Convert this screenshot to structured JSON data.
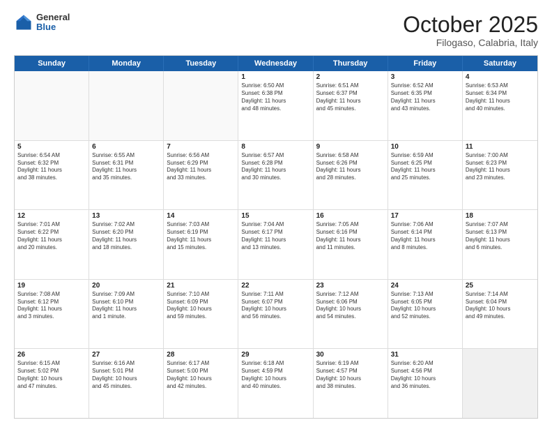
{
  "header": {
    "logo_general": "General",
    "logo_blue": "Blue",
    "month_title": "October 2025",
    "subtitle": "Filogaso, Calabria, Italy"
  },
  "weekdays": [
    "Sunday",
    "Monday",
    "Tuesday",
    "Wednesday",
    "Thursday",
    "Friday",
    "Saturday"
  ],
  "rows": [
    [
      {
        "day": "",
        "lines": [],
        "empty": true
      },
      {
        "day": "",
        "lines": [],
        "empty": true
      },
      {
        "day": "",
        "lines": [],
        "empty": true
      },
      {
        "day": "1",
        "lines": [
          "Sunrise: 6:50 AM",
          "Sunset: 6:38 PM",
          "Daylight: 11 hours",
          "and 48 minutes."
        ]
      },
      {
        "day": "2",
        "lines": [
          "Sunrise: 6:51 AM",
          "Sunset: 6:37 PM",
          "Daylight: 11 hours",
          "and 45 minutes."
        ]
      },
      {
        "day": "3",
        "lines": [
          "Sunrise: 6:52 AM",
          "Sunset: 6:35 PM",
          "Daylight: 11 hours",
          "and 43 minutes."
        ]
      },
      {
        "day": "4",
        "lines": [
          "Sunrise: 6:53 AM",
          "Sunset: 6:34 PM",
          "Daylight: 11 hours",
          "and 40 minutes."
        ]
      }
    ],
    [
      {
        "day": "5",
        "lines": [
          "Sunrise: 6:54 AM",
          "Sunset: 6:32 PM",
          "Daylight: 11 hours",
          "and 38 minutes."
        ]
      },
      {
        "day": "6",
        "lines": [
          "Sunrise: 6:55 AM",
          "Sunset: 6:31 PM",
          "Daylight: 11 hours",
          "and 35 minutes."
        ]
      },
      {
        "day": "7",
        "lines": [
          "Sunrise: 6:56 AM",
          "Sunset: 6:29 PM",
          "Daylight: 11 hours",
          "and 33 minutes."
        ]
      },
      {
        "day": "8",
        "lines": [
          "Sunrise: 6:57 AM",
          "Sunset: 6:28 PM",
          "Daylight: 11 hours",
          "and 30 minutes."
        ]
      },
      {
        "day": "9",
        "lines": [
          "Sunrise: 6:58 AM",
          "Sunset: 6:26 PM",
          "Daylight: 11 hours",
          "and 28 minutes."
        ]
      },
      {
        "day": "10",
        "lines": [
          "Sunrise: 6:59 AM",
          "Sunset: 6:25 PM",
          "Daylight: 11 hours",
          "and 25 minutes."
        ]
      },
      {
        "day": "11",
        "lines": [
          "Sunrise: 7:00 AM",
          "Sunset: 6:23 PM",
          "Daylight: 11 hours",
          "and 23 minutes."
        ]
      }
    ],
    [
      {
        "day": "12",
        "lines": [
          "Sunrise: 7:01 AM",
          "Sunset: 6:22 PM",
          "Daylight: 11 hours",
          "and 20 minutes."
        ]
      },
      {
        "day": "13",
        "lines": [
          "Sunrise: 7:02 AM",
          "Sunset: 6:20 PM",
          "Daylight: 11 hours",
          "and 18 minutes."
        ]
      },
      {
        "day": "14",
        "lines": [
          "Sunrise: 7:03 AM",
          "Sunset: 6:19 PM",
          "Daylight: 11 hours",
          "and 15 minutes."
        ]
      },
      {
        "day": "15",
        "lines": [
          "Sunrise: 7:04 AM",
          "Sunset: 6:17 PM",
          "Daylight: 11 hours",
          "and 13 minutes."
        ]
      },
      {
        "day": "16",
        "lines": [
          "Sunrise: 7:05 AM",
          "Sunset: 6:16 PM",
          "Daylight: 11 hours",
          "and 11 minutes."
        ]
      },
      {
        "day": "17",
        "lines": [
          "Sunrise: 7:06 AM",
          "Sunset: 6:14 PM",
          "Daylight: 11 hours",
          "and 8 minutes."
        ]
      },
      {
        "day": "18",
        "lines": [
          "Sunrise: 7:07 AM",
          "Sunset: 6:13 PM",
          "Daylight: 11 hours",
          "and 6 minutes."
        ]
      }
    ],
    [
      {
        "day": "19",
        "lines": [
          "Sunrise: 7:08 AM",
          "Sunset: 6:12 PM",
          "Daylight: 11 hours",
          "and 3 minutes."
        ]
      },
      {
        "day": "20",
        "lines": [
          "Sunrise: 7:09 AM",
          "Sunset: 6:10 PM",
          "Daylight: 11 hours",
          "and 1 minute."
        ]
      },
      {
        "day": "21",
        "lines": [
          "Sunrise: 7:10 AM",
          "Sunset: 6:09 PM",
          "Daylight: 10 hours",
          "and 59 minutes."
        ]
      },
      {
        "day": "22",
        "lines": [
          "Sunrise: 7:11 AM",
          "Sunset: 6:07 PM",
          "Daylight: 10 hours",
          "and 56 minutes."
        ]
      },
      {
        "day": "23",
        "lines": [
          "Sunrise: 7:12 AM",
          "Sunset: 6:06 PM",
          "Daylight: 10 hours",
          "and 54 minutes."
        ]
      },
      {
        "day": "24",
        "lines": [
          "Sunrise: 7:13 AM",
          "Sunset: 6:05 PM",
          "Daylight: 10 hours",
          "and 52 minutes."
        ]
      },
      {
        "day": "25",
        "lines": [
          "Sunrise: 7:14 AM",
          "Sunset: 6:04 PM",
          "Daylight: 10 hours",
          "and 49 minutes."
        ]
      }
    ],
    [
      {
        "day": "26",
        "lines": [
          "Sunrise: 6:15 AM",
          "Sunset: 5:02 PM",
          "Daylight: 10 hours",
          "and 47 minutes."
        ]
      },
      {
        "day": "27",
        "lines": [
          "Sunrise: 6:16 AM",
          "Sunset: 5:01 PM",
          "Daylight: 10 hours",
          "and 45 minutes."
        ]
      },
      {
        "day": "28",
        "lines": [
          "Sunrise: 6:17 AM",
          "Sunset: 5:00 PM",
          "Daylight: 10 hours",
          "and 42 minutes."
        ]
      },
      {
        "day": "29",
        "lines": [
          "Sunrise: 6:18 AM",
          "Sunset: 4:59 PM",
          "Daylight: 10 hours",
          "and 40 minutes."
        ]
      },
      {
        "day": "30",
        "lines": [
          "Sunrise: 6:19 AM",
          "Sunset: 4:57 PM",
          "Daylight: 10 hours",
          "and 38 minutes."
        ]
      },
      {
        "day": "31",
        "lines": [
          "Sunrise: 6:20 AM",
          "Sunset: 4:56 PM",
          "Daylight: 10 hours",
          "and 36 minutes."
        ]
      },
      {
        "day": "",
        "lines": [],
        "empty": true,
        "shaded": true
      }
    ]
  ]
}
